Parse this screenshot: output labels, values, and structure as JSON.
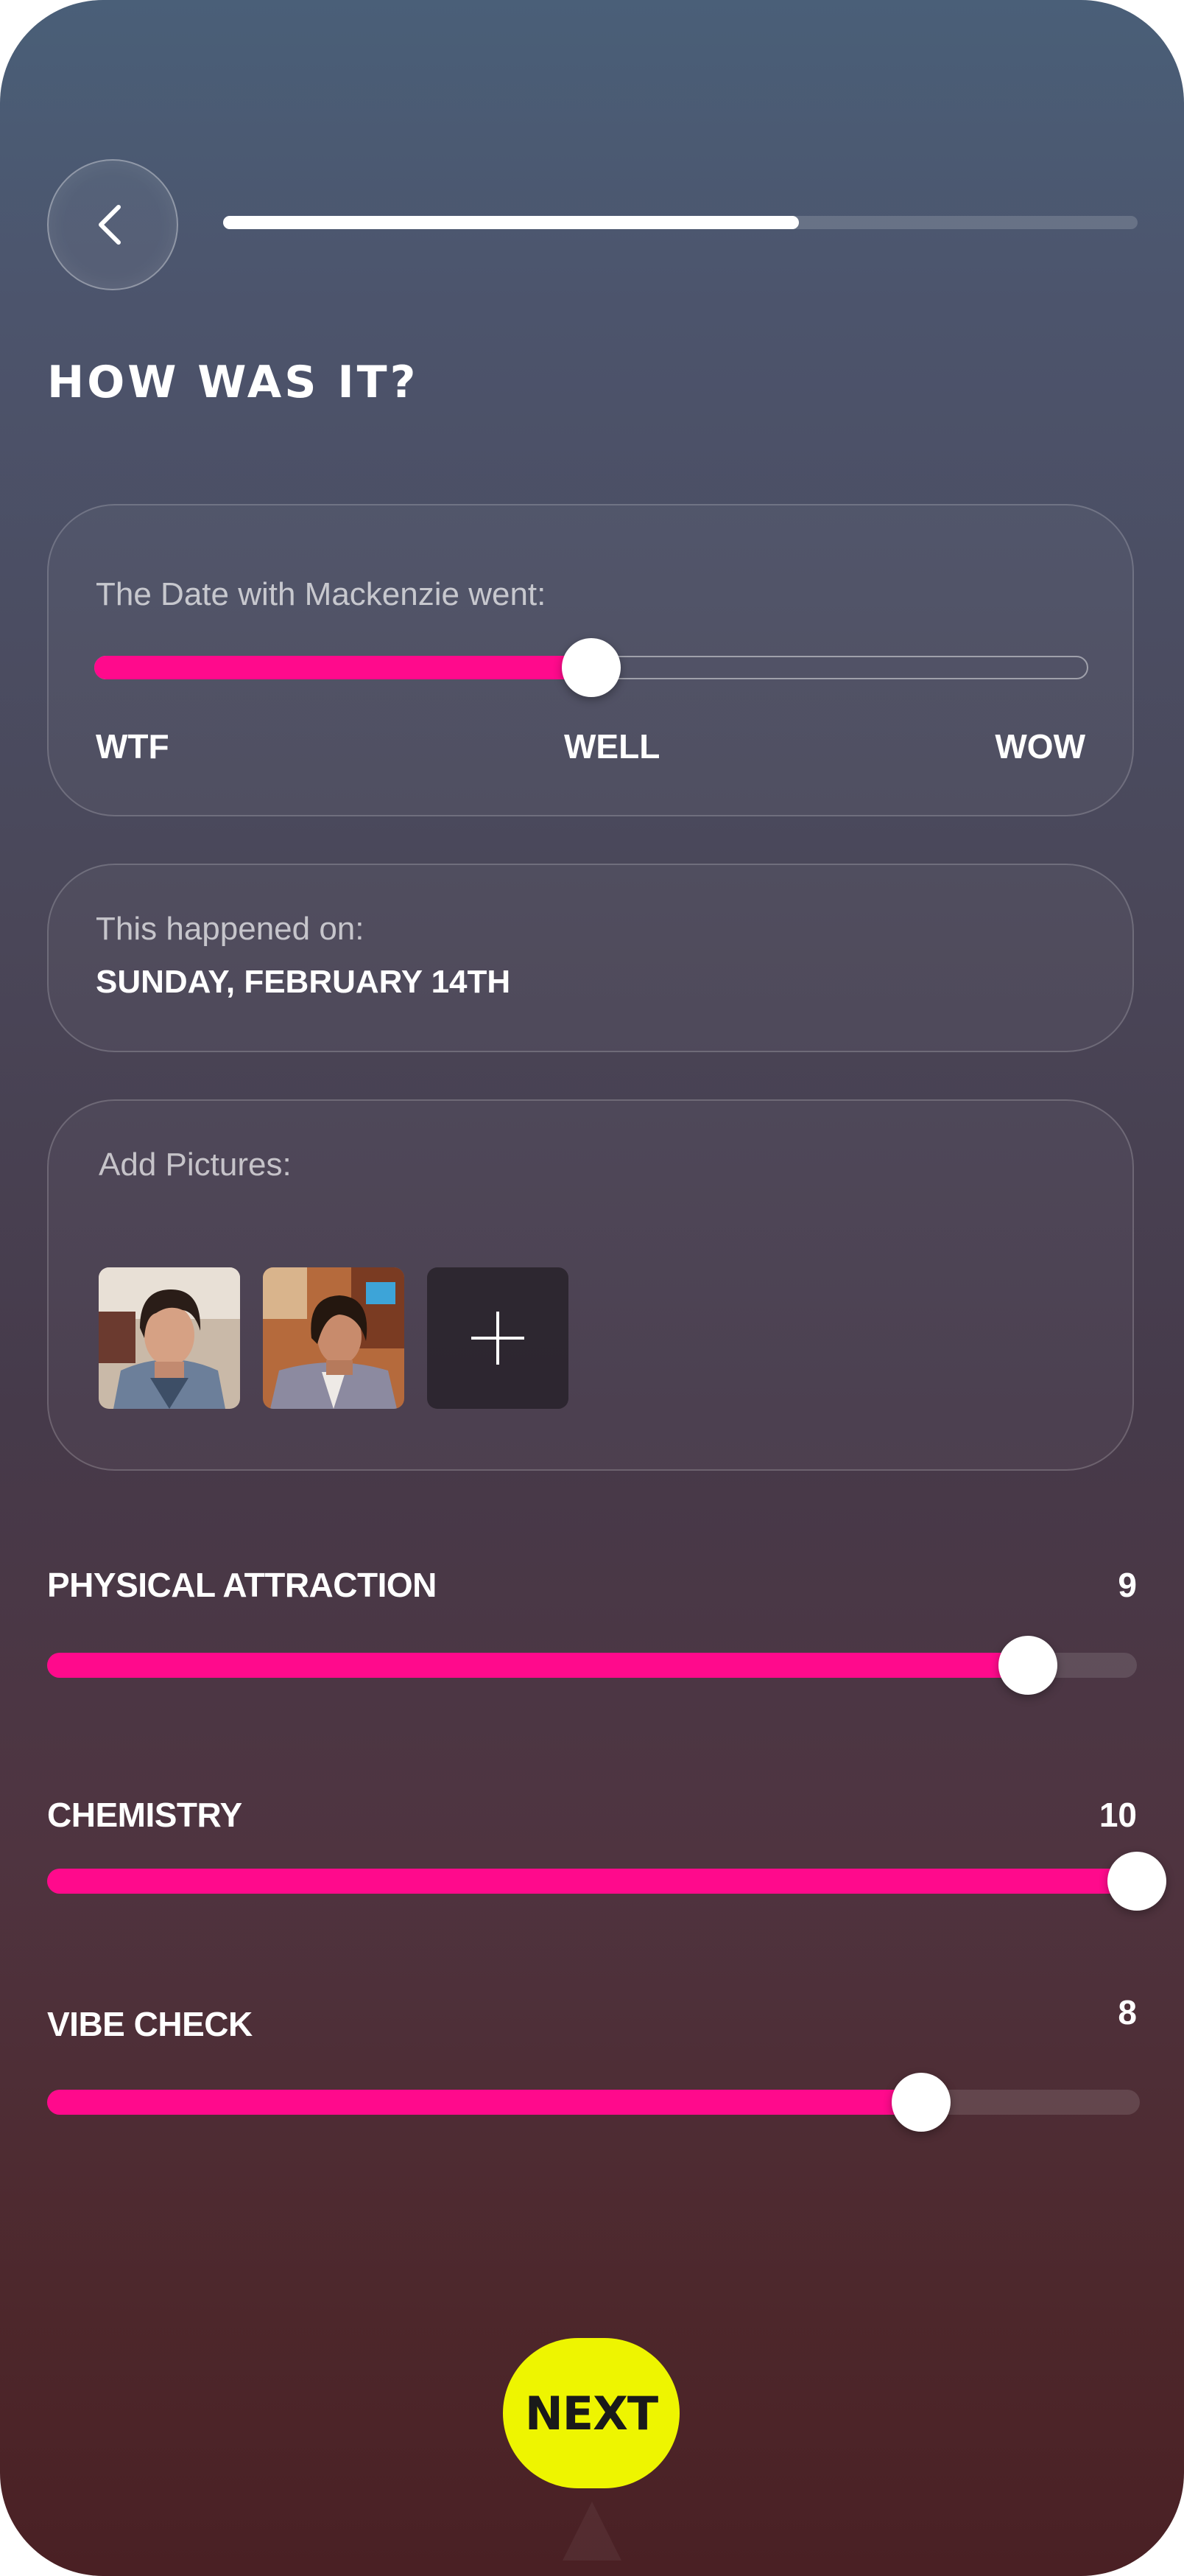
{
  "header": {
    "back_icon": "chevron-left-icon",
    "progress": 0.63
  },
  "page_title": "HOW WAS IT?",
  "mood_card": {
    "label": "The Date with Mackenzie went:",
    "value_fraction": 0.5,
    "labels": [
      "WTF",
      "WELL",
      "WOW"
    ]
  },
  "date_card": {
    "label": "This happened on:",
    "value": "SUNDAY, FEBRUARY 14TH"
  },
  "pictures_card": {
    "label": "Add Pictures:",
    "photos": [
      "photo-1",
      "photo-2"
    ],
    "add_icon": "plus-icon"
  },
  "metrics": [
    {
      "name": "PHYSICAL ATTRACTION",
      "value": "9",
      "fraction": 0.9
    },
    {
      "name": "CHEMISTRY",
      "value": "10",
      "fraction": 1.0
    },
    {
      "name": "VIBE CHECK",
      "value": "8",
      "fraction": 0.8
    }
  ],
  "next_button": {
    "label": "NEXT"
  },
  "colors": {
    "accent": "#ff0a8c",
    "next": "#eef500"
  }
}
